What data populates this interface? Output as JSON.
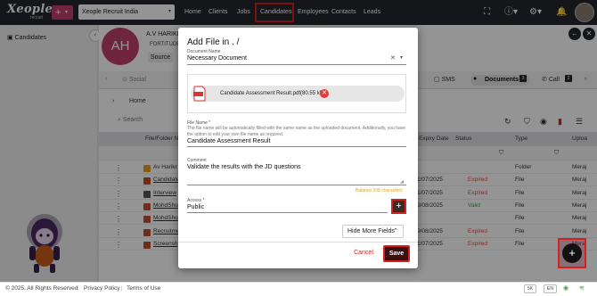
{
  "brand": {
    "logo": "Xeople",
    "logo_sub": "recruit",
    "add_icon": "plus-icon"
  },
  "company_select": {
    "value": "Xeople Recruit India"
  },
  "nav": [
    "Home",
    "Clients",
    "Jobs",
    "Candidates",
    "Employees",
    "Contacts",
    "Leads"
  ],
  "nav_active": "Candidates",
  "top_icons": [
    "fullscreen-icon",
    "help-icon",
    "settings-icon",
    "bell-icon",
    "user-avatar"
  ],
  "sidebar": {
    "title": "Candidates",
    "icon": "candidates-icon"
  },
  "candidate": {
    "initials": "AH",
    "name": "A.V HARIKR",
    "subtitle": "FORTITUDE",
    "source_label": "Source"
  },
  "tabs": {
    "social": "Social",
    "sms": "SMS",
    "documents": "Documents",
    "documents_count": "3",
    "call": "Call",
    "call_count": "2"
  },
  "breadcrumb": {
    "home": "Home"
  },
  "search": {
    "placeholder": "Search"
  },
  "table": {
    "columns": [
      "File/Folder N",
      "Expiry Date",
      "Status",
      "Type",
      "Uploa"
    ],
    "rows": [
      {
        "name": "Av Harikr",
        "expiry": "",
        "status": "",
        "type": "Folder",
        "uploader": "Meraj",
        "status_color": ""
      },
      {
        "name": "Candidate",
        "expiry": "1/07/2025",
        "status": "Expired",
        "type": "File",
        "uploader": "Meraj",
        "status_color": "#d9534f"
      },
      {
        "name": "Interview",
        "expiry": "1/07/2025",
        "status": "Expired",
        "type": "File",
        "uploader": "Meraj",
        "status_color": "#d9534f"
      },
      {
        "name": "MohdShu",
        "expiry": "9/08/2025",
        "status": "Valid",
        "type": "File",
        "uploader": "Meraj",
        "status_color": "#4a9a4a"
      },
      {
        "name": "MohdShu",
        "expiry": "",
        "status": "",
        "type": "File",
        "uploader": "Meraj",
        "status_color": ""
      },
      {
        "name": "Recruitme",
        "expiry": "9/08/2025",
        "status": "Expired",
        "type": "File",
        "uploader": "Meraj",
        "status_color": "#d9534f"
      },
      {
        "name": "Screensh",
        "expiry": "1/07/2025",
        "status": "Expired",
        "type": "File",
        "uploader": "Meraj",
        "status_color": "#d9534f"
      }
    ]
  },
  "modal": {
    "title": "Add File in . /",
    "document_name_label": "Document Name",
    "document_name_value": "Necessary Document",
    "attachment_name": "Candidate Assessment Result.pdf(80.55 kB)",
    "file_name_label": "File Name *",
    "file_name_hint": "The file name will be automatically filled with the same name as the uploaded document. Additionally, you have the option to edit your own file name as required.",
    "file_name_value": "Candidate Assessment Result",
    "comment_label": "Comment",
    "comment_value": "Validate the results with the JD questions",
    "comment_counter": "Balance 208 characters",
    "access_label": "Access *",
    "access_value": "Public",
    "hide_more_label": "Hide More Fields",
    "cancel_label": "Cancel",
    "save_label": "Save"
  },
  "footer": {
    "copyright": "© 2025. All Rights Reserved",
    "privacy": "Privacy Policy",
    "terms": "Terms of Use",
    "badges": [
      "5K",
      "EN"
    ]
  },
  "colors": {
    "topbar": "#23262e",
    "accent": "#c2416d",
    "highlight": "#d62020",
    "save": "#3a0f0f"
  }
}
